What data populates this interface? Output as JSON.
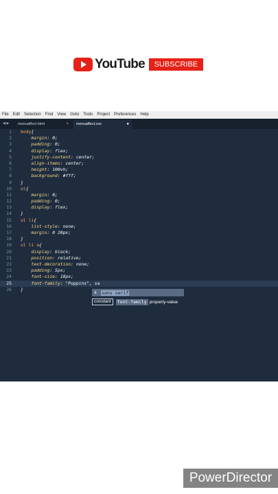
{
  "brand": {
    "name": "YouTube",
    "subscribe": "SUBSCRIBE"
  },
  "menu": [
    "File",
    "Edit",
    "Selection",
    "Find",
    "View",
    "Goto",
    "Tools",
    "Project",
    "Preferences",
    "Help"
  ],
  "tabs": [
    {
      "label": "menuaffect.html",
      "close": "×"
    },
    {
      "label": "menuaffect.css",
      "close": "●"
    }
  ],
  "tab_nav": "◀ ▶",
  "code": [
    {
      "n": "1",
      "parts": [
        [
          "sel",
          "body"
        ],
        [
          "punc",
          "{"
        ]
      ]
    },
    {
      "n": "2",
      "parts": [
        [
          "",
          "    "
        ],
        [
          "prop",
          "margin"
        ],
        [
          "punc",
          ": "
        ],
        [
          "val",
          "0"
        ],
        [
          "punc",
          ";"
        ]
      ]
    },
    {
      "n": "3",
      "parts": [
        [
          "",
          "    "
        ],
        [
          "prop",
          "padding"
        ],
        [
          "punc",
          ": "
        ],
        [
          "val",
          "0"
        ],
        [
          "punc",
          ";"
        ]
      ]
    },
    {
      "n": "4",
      "parts": [
        [
          "",
          "    "
        ],
        [
          "prop",
          "display"
        ],
        [
          "punc",
          ": "
        ],
        [
          "val",
          "flex"
        ],
        [
          "punc",
          ";"
        ]
      ]
    },
    {
      "n": "5",
      "parts": [
        [
          "",
          "    "
        ],
        [
          "prop",
          "justify-content"
        ],
        [
          "punc",
          ": "
        ],
        [
          "val",
          "center"
        ],
        [
          "punc",
          ";"
        ]
      ]
    },
    {
      "n": "6",
      "parts": [
        [
          "",
          "    "
        ],
        [
          "prop",
          "align-items"
        ],
        [
          "punc",
          ": "
        ],
        [
          "val",
          "center"
        ],
        [
          "punc",
          ";"
        ]
      ]
    },
    {
      "n": "7",
      "parts": [
        [
          "",
          "    "
        ],
        [
          "prop",
          "height"
        ],
        [
          "punc",
          ": "
        ],
        [
          "val",
          "100vh"
        ],
        [
          "punc",
          ";"
        ]
      ]
    },
    {
      "n": "8",
      "parts": [
        [
          "",
          "    "
        ],
        [
          "prop",
          "background"
        ],
        [
          "punc",
          ": "
        ],
        [
          "val",
          "#fff"
        ],
        [
          "punc",
          ";"
        ]
      ]
    },
    {
      "n": "9",
      "parts": [
        [
          "punc",
          "}"
        ]
      ]
    },
    {
      "n": "10",
      "parts": [
        [
          "sel",
          "ul"
        ],
        [
          "punc",
          "{"
        ]
      ]
    },
    {
      "n": "11",
      "parts": [
        [
          "",
          "    "
        ],
        [
          "prop",
          "margin"
        ],
        [
          "punc",
          ": "
        ],
        [
          "val",
          "0"
        ],
        [
          "punc",
          ";"
        ]
      ]
    },
    {
      "n": "12",
      "parts": [
        [
          "",
          "    "
        ],
        [
          "prop",
          "padding"
        ],
        [
          "punc",
          ": "
        ],
        [
          "val",
          "0"
        ],
        [
          "punc",
          ";"
        ]
      ]
    },
    {
      "n": "13",
      "parts": [
        [
          "",
          "    "
        ],
        [
          "prop",
          "display"
        ],
        [
          "punc",
          ": "
        ],
        [
          "val",
          "flex"
        ],
        [
          "punc",
          ";"
        ]
      ]
    },
    {
      "n": "14",
      "parts": [
        [
          "punc",
          "}"
        ]
      ]
    },
    {
      "n": "15",
      "parts": [
        [
          "sel",
          "ul li"
        ],
        [
          "punc",
          "{"
        ]
      ]
    },
    {
      "n": "16",
      "parts": [
        [
          "",
          "    "
        ],
        [
          "prop",
          "list-style"
        ],
        [
          "punc",
          ": "
        ],
        [
          "val",
          "none"
        ],
        [
          "punc",
          ";"
        ]
      ]
    },
    {
      "n": "17",
      "parts": [
        [
          "",
          "    "
        ],
        [
          "prop",
          "margin"
        ],
        [
          "punc",
          ": "
        ],
        [
          "val",
          "0 20px"
        ],
        [
          "punc",
          ";"
        ]
      ]
    },
    {
      "n": "18",
      "parts": [
        [
          "punc",
          "}"
        ]
      ]
    },
    {
      "n": "19",
      "parts": [
        [
          "sel",
          "ul li a"
        ],
        [
          "punc",
          "{"
        ]
      ]
    },
    {
      "n": "20",
      "parts": [
        [
          "",
          "    "
        ],
        [
          "prop",
          "display"
        ],
        [
          "punc",
          ": "
        ],
        [
          "val",
          "block"
        ],
        [
          "punc",
          ";"
        ]
      ]
    },
    {
      "n": "21",
      "parts": [
        [
          "",
          "    "
        ],
        [
          "prop",
          "position"
        ],
        [
          "punc",
          ": "
        ],
        [
          "val",
          "relative"
        ],
        [
          "punc",
          ";"
        ]
      ]
    },
    {
      "n": "22",
      "parts": [
        [
          "",
          "    "
        ],
        [
          "prop",
          "text-decoration"
        ],
        [
          "punc",
          ": "
        ],
        [
          "val",
          "none"
        ],
        [
          "punc",
          ";"
        ]
      ]
    },
    {
      "n": "23",
      "parts": [
        [
          "",
          "    "
        ],
        [
          "prop",
          "padding"
        ],
        [
          "punc",
          ": "
        ],
        [
          "val",
          "5px"
        ],
        [
          "punc",
          ";"
        ]
      ]
    },
    {
      "n": "24",
      "parts": [
        [
          "",
          "    "
        ],
        [
          "prop",
          "font-size"
        ],
        [
          "punc",
          ": "
        ],
        [
          "val",
          "18px"
        ],
        [
          "punc",
          ";"
        ]
      ]
    },
    {
      "n": "25",
      "parts": [
        [
          "",
          "    "
        ],
        [
          "prop",
          "font-family"
        ],
        [
          "punc",
          ": "
        ],
        [
          "val",
          "\"Poppins\", sa"
        ]
      ],
      "active": true
    },
    {
      "n": "26",
      "parts": [
        [
          "punc",
          "}"
        ]
      ]
    }
  ],
  "autocomplete": {
    "badge": "c",
    "suggestion": "sans serif",
    "kind": "constant",
    "name": "font-family",
    "desc": "property-value"
  },
  "watermark": "PowerDirector"
}
